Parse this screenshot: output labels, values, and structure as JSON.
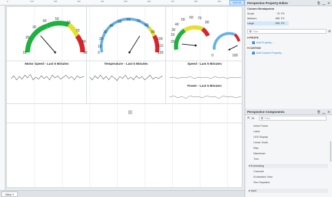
{
  "ruler": {
    "ticks": [
      "0",
      "100",
      "200",
      "300",
      "400",
      "500",
      "600",
      "700",
      "800",
      "900"
    ],
    "selected_tab": "1041.00"
  },
  "charts": {
    "gauge1": {
      "labels": [
        "10",
        "20",
        "30",
        "40",
        "50",
        "60",
        "70",
        "80",
        "90"
      ],
      "title": "Motor Speed - Last 5 Minutes"
    },
    "gauge2": {
      "labels": [
        "0",
        "10",
        "20",
        "30",
        "40",
        "50",
        "60",
        "70",
        "80",
        "90",
        "100",
        "110",
        "120"
      ],
      "title": "Temperature - Last 5 Minutes"
    },
    "gauge3": {
      "labels": [
        "10",
        "20",
        "30",
        "40",
        "50",
        "60",
        "70",
        "80"
      ],
      "title_speed": "Speed - Last 5 Minutes"
    },
    "gauge4": {
      "labels": [
        "0",
        "100"
      ]
    },
    "power_title": "Power - Last 5 Minutes"
  },
  "bottom": {
    "view_tab": "View ×"
  },
  "property_editor": {
    "title": "Perspective Property Editor",
    "section": "Column Breakpoints",
    "breakpoints": [
      {
        "name": "Small",
        "value": "75",
        "unit": "PX"
      },
      {
        "name": "Medium",
        "value": "985",
        "unit": "PX"
      },
      {
        "name": "Large",
        "value": "999",
        "unit": "PX"
      }
    ],
    "search_placeholder": "Filter",
    "props_label": "PROPS",
    "add_property": "Add Property...",
    "custom_label": "CUSTOM",
    "add_custom": "Add Custom Property..."
  },
  "components": {
    "title": "Perspective Components",
    "search_placeholder": "Filter",
    "items": [
      "Inline Frame",
      "Label",
      "LED Display",
      "Linear Scale",
      "Map",
      "Markdown",
      "Tree"
    ],
    "groups": [
      "Embedding",
      "Input"
    ],
    "embed_items": [
      "Carousel",
      "Embedded View",
      "Flex Repeater"
    ]
  },
  "colors": {
    "gauge_red": "#d9232b",
    "gauge_yellow": "#e5e030",
    "gauge_green": "#1fb13f",
    "gauge_blue": "#62b3ea"
  }
}
